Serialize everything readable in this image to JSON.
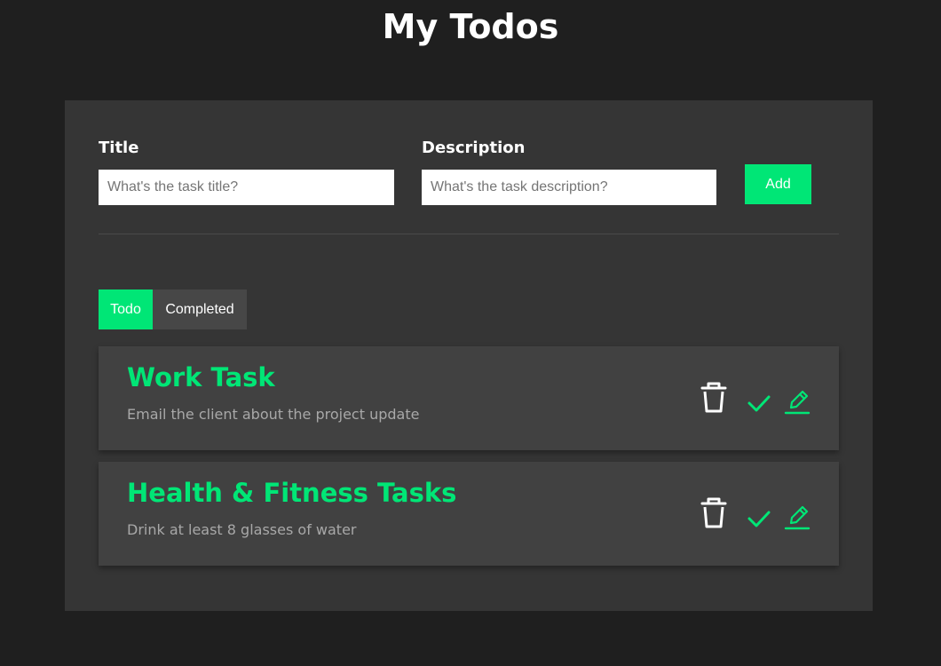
{
  "header": {
    "title": "My Todos"
  },
  "form": {
    "title_label": "Title",
    "title_placeholder": "What's the task title?",
    "title_value": "",
    "description_label": "Description",
    "description_placeholder": "What's the task description?",
    "description_value": "",
    "add_label": "Add"
  },
  "tabs": [
    {
      "label": "Todo",
      "active": true
    },
    {
      "label": "Completed",
      "active": false
    }
  ],
  "todos": [
    {
      "title": "Work Task",
      "description": "Email the client about the project update"
    },
    {
      "title": "Health & Fitness Tasks",
      "description": "Drink at least 8 glasses of water"
    }
  ],
  "icons": {
    "delete": "trash-icon",
    "complete": "check-icon",
    "edit": "pencil-icon"
  },
  "colors": {
    "accent": "#00e676",
    "background": "#1f1f1f",
    "panel": "#353535",
    "card": "#414141",
    "inactive_tab": "#474747",
    "muted_text": "#a8a8a8"
  }
}
